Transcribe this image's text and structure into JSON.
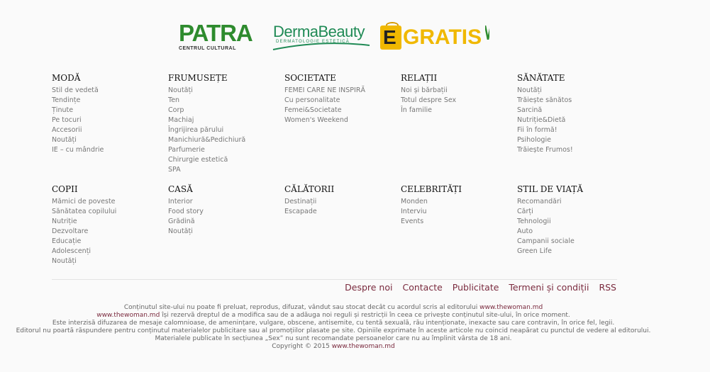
{
  "partners": {
    "patra": {
      "big": "PATRA",
      "small": "CENTRUL CULTURAL"
    },
    "derma": {
      "big": "DermaBeauty",
      "small": "DERMATOLOGIE ESTETICĂ"
    },
    "gratis": {
      "letter": "E",
      "text": "GRATIS"
    }
  },
  "categories": [
    {
      "title": "MODĂ",
      "items": [
        "Stil de vedetă",
        "Tendințe",
        "Ținute",
        "Pe tocuri",
        "Accesorii",
        "Noutăți",
        "IE – cu mândrie"
      ]
    },
    {
      "title": "FRUMUSEȚE",
      "items": [
        "Noutăți",
        "Ten",
        "Corp",
        "Machiaj",
        "Îngrijirea părului",
        "Manichiură&Pedichiură",
        "Parfumerie",
        "Chirurgie estetică",
        "SPA"
      ]
    },
    {
      "title": "SOCIETATE",
      "items": [
        "FEMEI CARE NE INSPIRĂ",
        "Cu personalitate",
        "Femei&Societate",
        "Women's Weekend"
      ]
    },
    {
      "title": "RELAȚII",
      "items": [
        "Noi și bărbații",
        "Totul despre Sex",
        "În familie"
      ]
    },
    {
      "title": "SĂNĂTATE",
      "items": [
        "Noutăți",
        "Trăiește sănătos",
        "Sarcină",
        "Nutriție&Dietă",
        "Fii în formă!",
        "Psihologie",
        "Trăiește Frumos!"
      ]
    },
    {
      "title": "COPII",
      "items": [
        "Mămici de poveste",
        "Sănătatea copilului",
        "Nutriție",
        "Dezvoltare",
        "Educație",
        "Adolescenți",
        "Noutăți"
      ]
    },
    {
      "title": "CASĂ",
      "items": [
        "Interior",
        "Food story",
        "Grădină",
        "Noutăți"
      ]
    },
    {
      "title": "CĂLĂTORII",
      "items": [
        "Destinații",
        "Escapade"
      ]
    },
    {
      "title": "CELEBRITĂȚI",
      "items": [
        "Monden",
        "Interviu",
        "Events"
      ]
    },
    {
      "title": "STIL DE VIAȚĂ",
      "items": [
        "Recomandări",
        "Cărți",
        "Tehnologii",
        "Auto",
        "Campanii sociale",
        "Green Life"
      ]
    }
  ],
  "footer_nav": [
    "Despre noi",
    "Contacte",
    "Publicitate",
    "Termeni și condiții",
    "RSS"
  ],
  "legal": {
    "line1_text": "Conținutul site-ului nu poate fi preluat, reprodus, difuzat, vândut sau stocat decât cu acordul scris al editorului ",
    "line1_link": "www.thewoman.md",
    "line2_link": "www.thewoman.md",
    "line2_text": " își rezervă dreptul de a modifica sau de a adăuga noi reguli și restricții în ceea ce privește conținutul site-ului, în orice moment.",
    "line3": "Este interzisă difuzarea de mesaje calomnioase, de amenințare, vulgare, obscene, antisemite, cu tentă sexuală, rău intenționate, inexacte sau care contravin, în orice fel, legii.",
    "line4": "Editorul nu poartă răspundere pentru conținutul materialelor publicitare sau al promoțiilor plasate pe site. Opiniile exprimate în aceste articole nu coincid neapărat cu punctul de vedere al editorului.",
    "line5": "Materialele publicate în secțiunea „Sex” nu sunt recomandate persoanelor care nu au împlinit vârsta de 18 ani.",
    "copyright_text": "Copyright © 2015 ",
    "copyright_link": "www.thewoman.md"
  }
}
